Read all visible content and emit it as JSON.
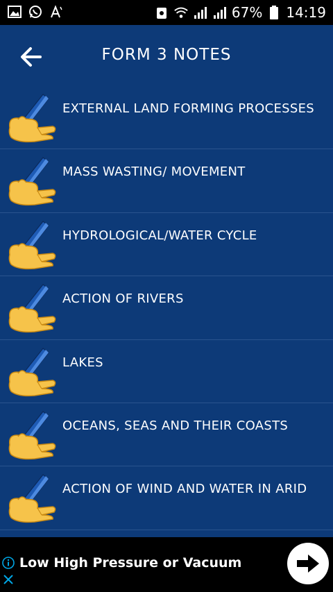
{
  "status_bar": {
    "battery_percent": "67%",
    "time": "14:19",
    "left_icons": [
      "gallery-icon",
      "whatsapp-icon",
      "text-a-icon"
    ],
    "right_icons": [
      "recycle-icon",
      "wifi-icon",
      "signal-icon",
      "signal-icon",
      "battery-icon"
    ]
  },
  "header": {
    "title": "FORM 3 NOTES",
    "back_icon": "arrow-left-icon"
  },
  "list": {
    "items": [
      {
        "label": "EXTERNAL LAND FORMING PROCESSES",
        "icon": "writing-hand-icon"
      },
      {
        "label": "MASS WASTING/ MOVEMENT",
        "icon": "writing-hand-icon"
      },
      {
        "label": "HYDROLOGICAL/WATER CYCLE",
        "icon": "writing-hand-icon"
      },
      {
        "label": "ACTION OF RIVERS",
        "icon": "writing-hand-icon"
      },
      {
        "label": "LAKES",
        "icon": "writing-hand-icon"
      },
      {
        "label": "OCEANS, SEAS AND THEIR COASTS",
        "icon": "writing-hand-icon"
      },
      {
        "label": "ACTION OF WIND AND WATER IN ARID",
        "icon": "writing-hand-icon"
      }
    ]
  },
  "ad": {
    "text": "Low High Pressure or Vacuum",
    "cta_icon": "arrow-right-icon"
  },
  "colors": {
    "header_bg": "#0d3a78",
    "list_bg": "#0d3a78",
    "divider": "#2a548e",
    "status_bg": "#000000"
  }
}
